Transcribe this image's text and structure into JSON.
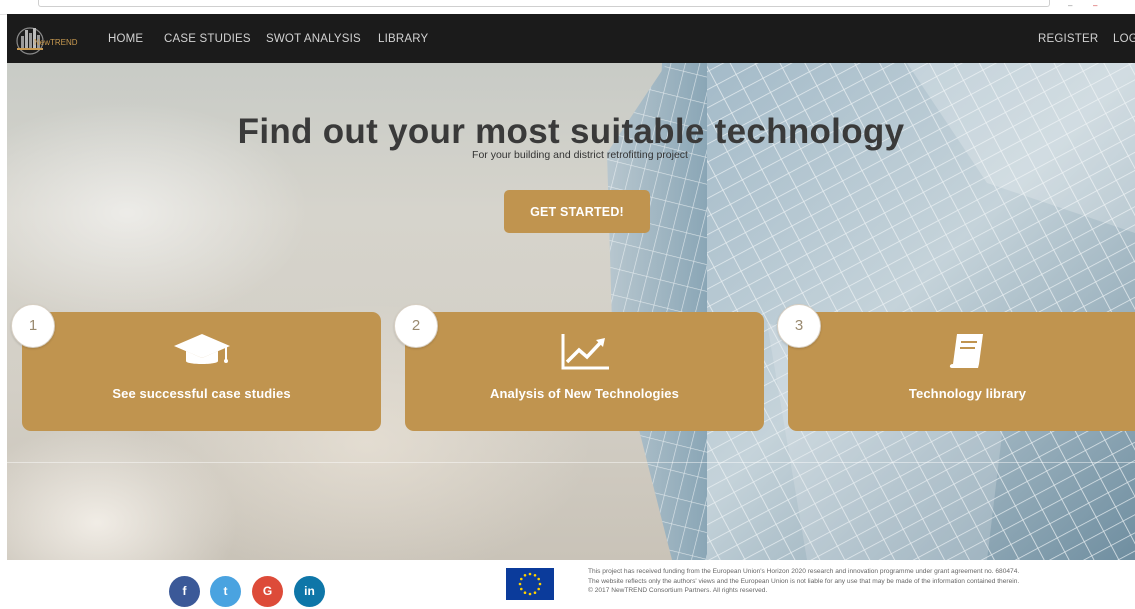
{
  "brand": {
    "logo_text": "NewTREND"
  },
  "nav": {
    "items": [
      "HOME",
      "CASE STUDIES",
      "SWOT ANALYSIS",
      "LIBRARY"
    ],
    "register": "REGISTER",
    "login": "LOG"
  },
  "hero": {
    "title": "Find out your most suitable technology",
    "subtitle": "For your building and district retrofitting project",
    "cta_label": "GET STARTED!"
  },
  "steps": [
    {
      "number": "1",
      "label": "See successful case studies",
      "icon": "graduation-cap-icon"
    },
    {
      "number": "2",
      "label": "Analysis of New Technologies",
      "icon": "trend-chart-icon"
    },
    {
      "number": "3",
      "label": "Technology library",
      "icon": "book-icon"
    }
  ],
  "social": [
    {
      "glyph": "f",
      "name": "facebook",
      "color": "#3b5998"
    },
    {
      "glyph": "t",
      "name": "twitter",
      "color": "#4aa3e0"
    },
    {
      "glyph": "G",
      "name": "google-plus",
      "color": "#dd4b39"
    },
    {
      "glyph": "in",
      "name": "linkedin",
      "color": "#0e76a8"
    }
  ],
  "footer": {
    "line1": "This project has received funding from the European Union's Horizon 2020 research and innovation programme under grant agreement no. 680474.",
    "line2": "The website reflects only the authors' views and the European Union is not liable for any use that may be made of the information contained therein.",
    "line3": "© 2017 NewTREND Consortium Partners. All rights reserved."
  },
  "colors": {
    "accent": "#c0944f",
    "navbar": "#1b1b1b",
    "title": "#3a3a3a"
  }
}
